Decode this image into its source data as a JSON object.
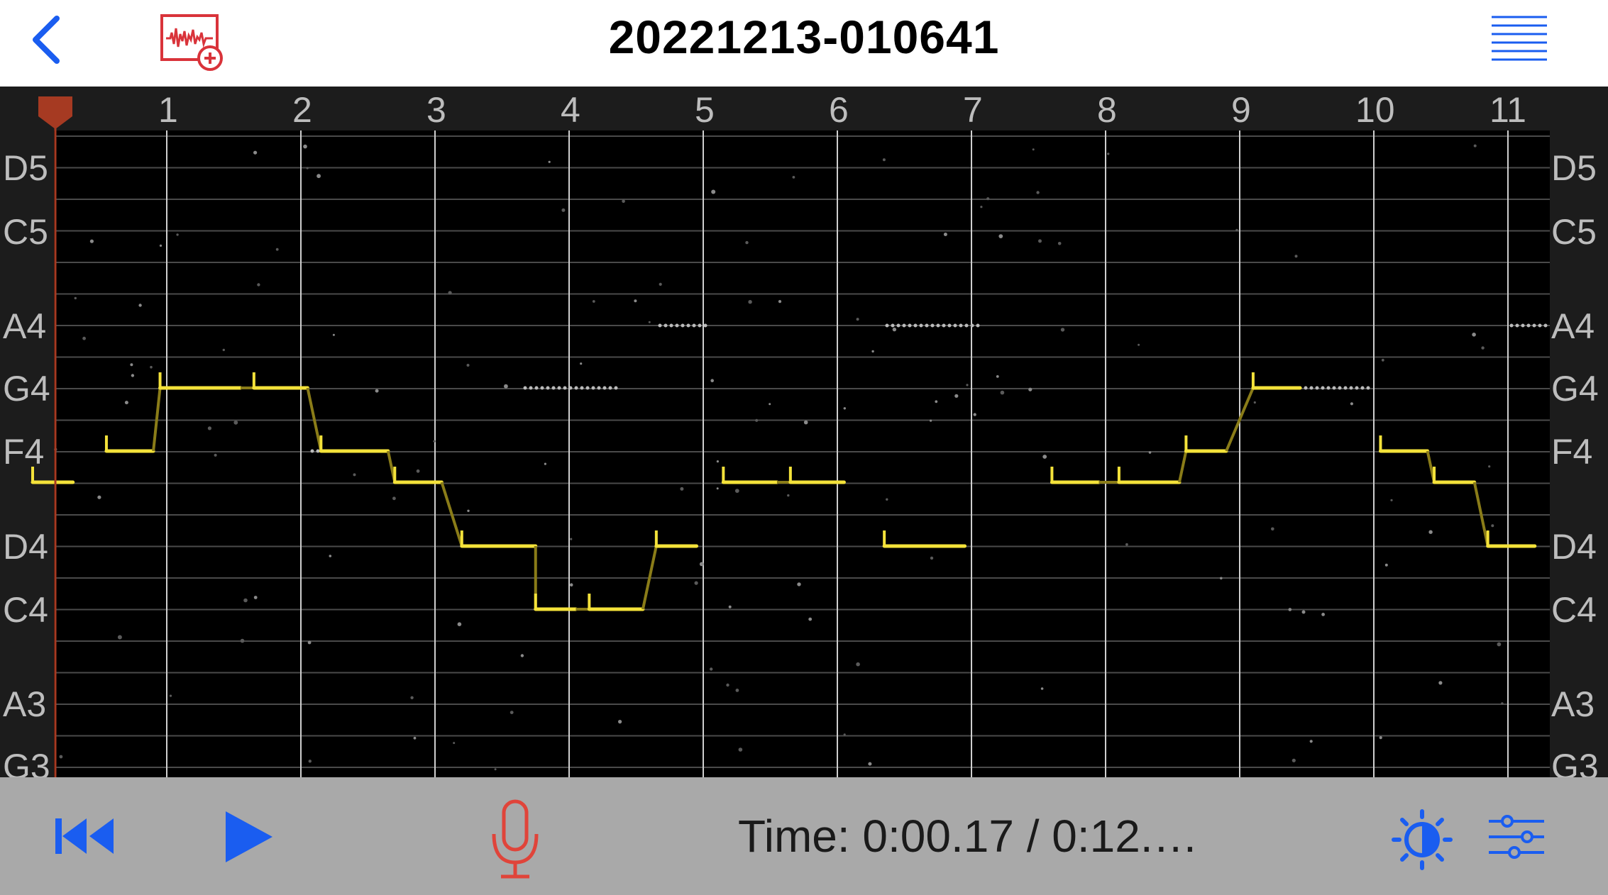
{
  "header": {
    "title": "20221213-010641",
    "back_icon": "chevron-left-icon",
    "add_icon": "waveform-add-icon",
    "menu_icon": "list-lines-icon",
    "accent": "#1a5df0",
    "add_color": "#d9333a"
  },
  "ruler": {
    "ticks": [
      "1",
      "2",
      "3",
      "4",
      "5",
      "6",
      "7",
      "8",
      "9",
      "10",
      "11"
    ],
    "playhead_color": "#a63a22"
  },
  "pitch_axis": {
    "labels": [
      "D5",
      "C5",
      "A4",
      "G4",
      "F4",
      "D4",
      "C4",
      "A3",
      "G3"
    ]
  },
  "pitch_trace": {
    "color": "#f4e23a",
    "segments": [
      {
        "start": 0.0,
        "end": 0.3,
        "note": "E4"
      },
      {
        "start": 0.55,
        "end": 0.9,
        "note": "F4"
      },
      {
        "start": 0.95,
        "end": 1.55,
        "note": "G4"
      },
      {
        "start": 1.65,
        "end": 2.05,
        "note": "G4"
      },
      {
        "start": 2.15,
        "end": 2.65,
        "note": "F4"
      },
      {
        "start": 2.7,
        "end": 3.05,
        "note": "E4"
      },
      {
        "start": 3.2,
        "end": 3.75,
        "note": "D4"
      },
      {
        "start": 3.75,
        "end": 4.05,
        "note": "C4"
      },
      {
        "start": 4.15,
        "end": 4.55,
        "note": "C4"
      },
      {
        "start": 4.65,
        "end": 4.95,
        "note": "D4"
      },
      {
        "start": 5.15,
        "end": 5.55,
        "note": "E4"
      },
      {
        "start": 5.65,
        "end": 6.05,
        "note": "E4"
      },
      {
        "start": 6.35,
        "end": 6.95,
        "note": "D4"
      },
      {
        "start": 7.6,
        "end": 7.95,
        "note": "E4"
      },
      {
        "start": 8.1,
        "end": 8.55,
        "note": "E4"
      },
      {
        "start": 8.6,
        "end": 8.9,
        "note": "F4"
      },
      {
        "start": 9.1,
        "end": 9.45,
        "note": "G4"
      },
      {
        "start": 10.05,
        "end": 10.4,
        "note": "F4"
      },
      {
        "start": 10.45,
        "end": 10.75,
        "note": "E4"
      },
      {
        "start": 10.85,
        "end": 11.2,
        "note": "D4"
      }
    ]
  },
  "controls": {
    "rewind_icon": "skip-back-icon",
    "play_icon": "play-icon",
    "mic_icon": "microphone-icon",
    "mic_color": "#e0443a",
    "time": "Time: 0:00.17 / 0:12.…",
    "brightness_icon": "brightness-icon",
    "settings_icon": "sliders-icon"
  }
}
